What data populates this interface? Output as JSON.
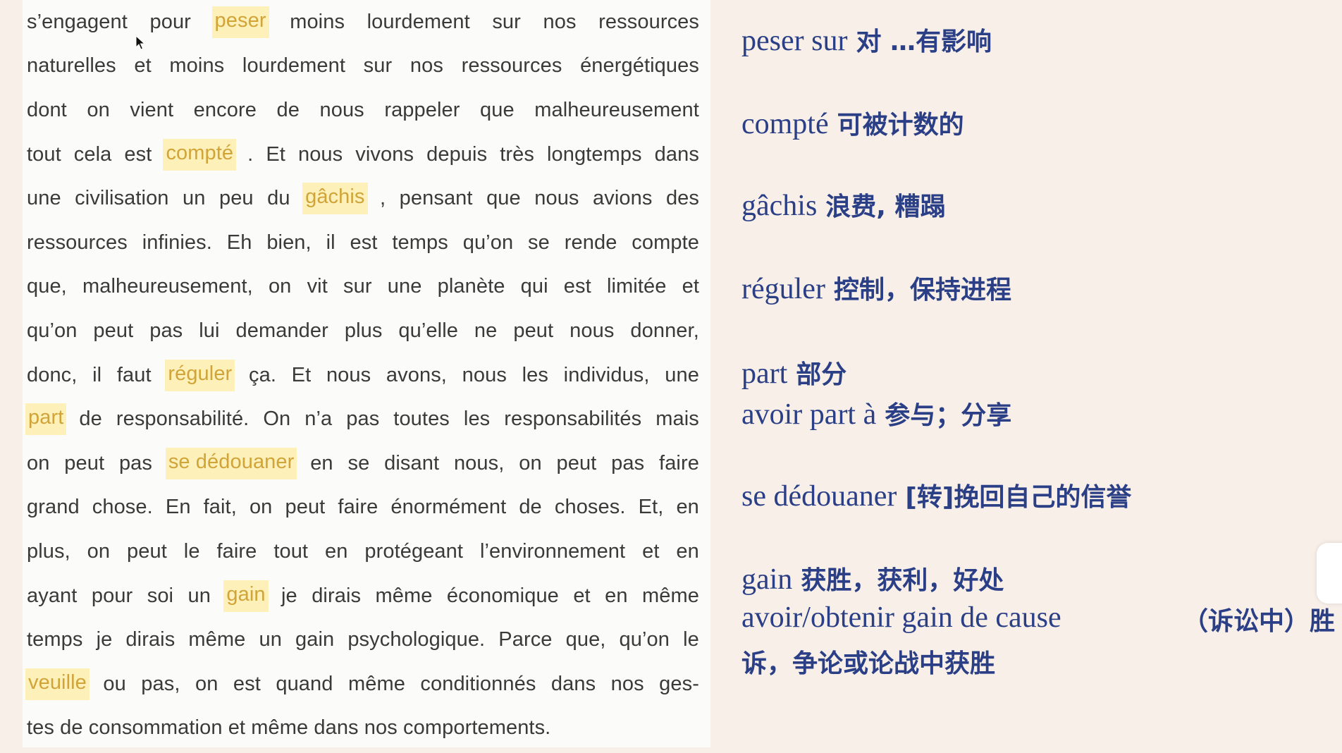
{
  "text": {
    "lines": [
      [
        {
          "t": "s’engagent pour "
        },
        {
          "t": "peser",
          "hl": true
        },
        {
          "t": " moins lourdement sur nos ressources"
        }
      ],
      [
        {
          "t": "naturelles et moins lourdement sur nos ressources énergétiques"
        }
      ],
      [
        {
          "t": "dont on vient encore de nous rappeler que malheureusement"
        }
      ],
      [
        {
          "t": "tout cela est "
        },
        {
          "t": "compté",
          "hl": true
        },
        {
          "t": ". Et nous vivons depuis très longtemps dans"
        }
      ],
      [
        {
          "t": "une civilisation un peu du "
        },
        {
          "t": "gâchis",
          "hl": true
        },
        {
          "t": ", pensant que nous avions des"
        }
      ],
      [
        {
          "t": "ressources infinies. Eh bien, il est temps qu’on se rende compte"
        }
      ],
      [
        {
          "t": "que, malheureusement, on vit sur une planète qui est limitée et"
        }
      ],
      [
        {
          "t": "qu’on peut pas lui demander plus qu’elle ne peut nous donner,"
        }
      ],
      [
        {
          "t": "donc, il faut "
        },
        {
          "t": "réguler",
          "hl": true
        },
        {
          "t": " ça. Et nous avons, nous les individus, une"
        }
      ],
      [
        {
          "t": "part",
          "hl": true
        },
        {
          "t": " de responsabilité. On n’a pas toutes les responsabilités mais"
        }
      ],
      [
        {
          "t": "on peut pas "
        },
        {
          "t": "se dédouaner",
          "hl": true
        },
        {
          "t": " en se disant nous, on peut pas faire"
        }
      ],
      [
        {
          "t": "grand chose. En fait, on peut faire énormément de choses. Et, en"
        }
      ],
      [
        {
          "t": "plus, on peut le faire tout en protégeant l’environnement et en"
        }
      ],
      [
        {
          "t": "ayant pour soi un "
        },
        {
          "t": "gain",
          "hl": true
        },
        {
          "t": " je dirais même économique et en même"
        }
      ],
      [
        {
          "t": "temps je dirais même un gain psychologique. Parce que, qu’on le"
        }
      ],
      [
        {
          "t": "veuille",
          "hl": true
        },
        {
          "t": " ou pas, on est quand même conditionnés dans nos ges-"
        }
      ],
      [
        {
          "t": "tes de consommation et même dans nos comportements."
        }
      ]
    ]
  },
  "vocab": [
    {
      "fr": "peser sur",
      "zh": "对 …有影响"
    },
    {
      "fr": "compté",
      "zh": "可被计数的"
    },
    {
      "fr": "gâchis",
      "zh": "浪费, 糟蹋"
    },
    {
      "fr": "réguler",
      "zh": "控制，保持进程"
    },
    {
      "fr": "part",
      "zh": "部分"
    },
    {
      "fr": "avoir part à",
      "zh": "参与；分享"
    },
    {
      "fr": "se dédouaner",
      "zh": "[转]挽回自己的信誉"
    },
    {
      "fr": "gain",
      "zh": "获胜，获利，好处"
    },
    {
      "fr": "avoir/obtenir gain de cause",
      "zh": "（诉讼中）胜"
    },
    {
      "fr": "",
      "zh": "诉，争论或论战中获胜"
    }
  ],
  "colors": {
    "page_bg": "#f7efe8",
    "text_panel_bg": "#fbfbfa",
    "body_text": "#3a3a3a",
    "highlight_bg": "#fdf0b8",
    "highlight_text": "#d1a43a",
    "vocab_text": "#2b3f86"
  },
  "icons": {
    "cursor": "mouse-pointer-icon"
  }
}
